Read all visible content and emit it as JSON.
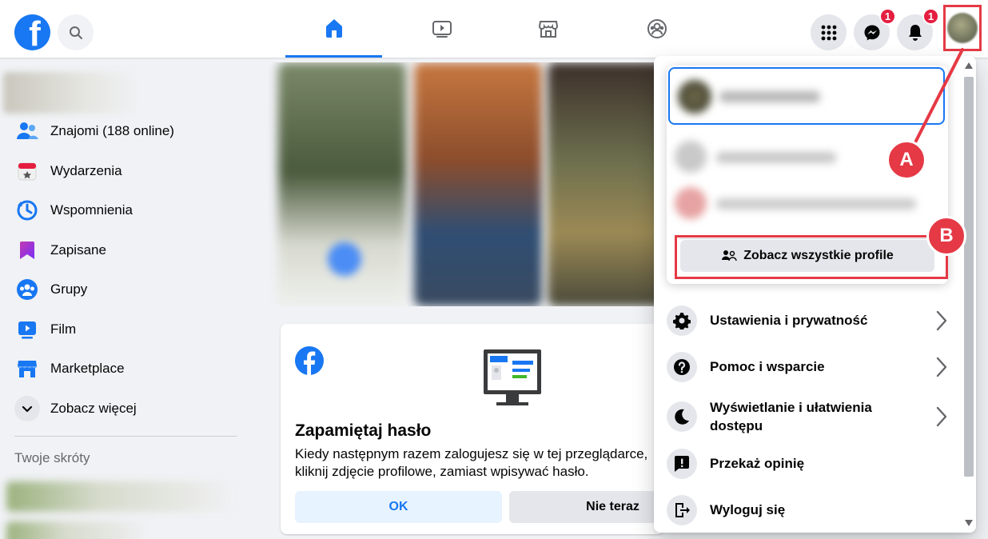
{
  "colors": {
    "brand": "#1877f2",
    "annotation": "#e53945",
    "badge": "#e41e3f"
  },
  "topbar": {
    "logo_letter": "f",
    "messenger_badge": "1",
    "notifications_badge": "1"
  },
  "sidebar": {
    "items": [
      {
        "label": "Znajomi (188 online)",
        "icon": "friends-icon"
      },
      {
        "label": "Wydarzenia",
        "icon": "calendar-icon"
      },
      {
        "label": "Wspomnienia",
        "icon": "clock-icon"
      },
      {
        "label": "Zapisane",
        "icon": "bookmark-icon"
      },
      {
        "label": "Grupy",
        "icon": "groups-icon"
      },
      {
        "label": "Film",
        "icon": "video-icon"
      },
      {
        "label": "Marketplace",
        "icon": "store-icon"
      },
      {
        "label": "Zobacz więcej",
        "icon": "chevron-down-icon"
      }
    ],
    "shortcuts_heading": "Twoje skróty"
  },
  "card": {
    "title": "Zapamiętaj hasło",
    "text": "Kiedy następnym razem zalogujesz się w tej przeglądarce, kliknij zdjęcie profilowe, zamiast wpisywać hasło.",
    "ok_label": "OK",
    "not_now_label": "Nie teraz"
  },
  "menu": {
    "see_all_profiles": "Zobacz wszystkie profile",
    "items": [
      {
        "label": "Ustawienia i prywatność",
        "icon": "gear-icon",
        "chevron": true
      },
      {
        "label": "Pomoc i wsparcie",
        "icon": "question-icon",
        "chevron": true
      },
      {
        "label": "Wyświetlanie i ułatwienia dostępu",
        "icon": "moon-icon",
        "chevron": true
      },
      {
        "label": "Przekaż opinię",
        "icon": "feedback-icon",
        "chevron": false
      },
      {
        "label": "Wyloguj się",
        "icon": "logout-icon",
        "chevron": false
      }
    ]
  },
  "annotations": {
    "a": "A",
    "b": "B"
  }
}
